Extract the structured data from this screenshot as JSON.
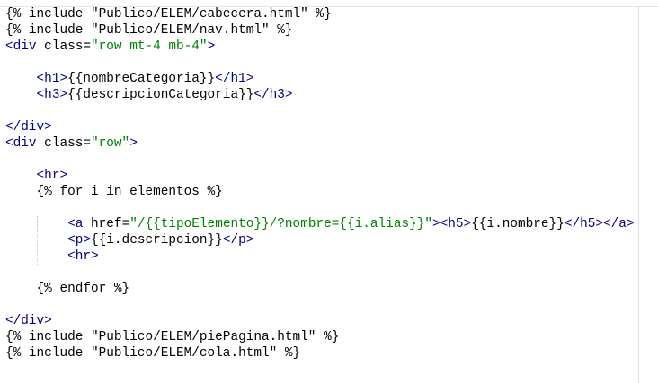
{
  "editor": {
    "lines": [
      [
        {
          "t": "{% include \"Publico/ELEM/cabecera.html\" %}",
          "c": "plain"
        }
      ],
      [
        {
          "t": "{% include \"Publico/ELEM/nav.html\" %}",
          "c": "plain"
        }
      ],
      [
        {
          "t": "<div",
          "c": "tag"
        },
        {
          "t": " class",
          "c": "attr"
        },
        {
          "t": "=",
          "c": "eq"
        },
        {
          "t": "\"row mt-4 mb-4\"",
          "c": "str"
        },
        {
          "t": ">",
          "c": "tag"
        }
      ],
      [],
      [
        {
          "t": "    ",
          "c": "plain"
        },
        {
          "t": "<h1>",
          "c": "tag"
        },
        {
          "t": "{{nombreCategoria}}",
          "c": "plain"
        },
        {
          "t": "</h1>",
          "c": "tag"
        }
      ],
      [
        {
          "t": "    ",
          "c": "plain"
        },
        {
          "t": "<h3>",
          "c": "tag"
        },
        {
          "t": "{{descripcionCategoria}}",
          "c": "plain"
        },
        {
          "t": "</h3>",
          "c": "tag"
        }
      ],
      [],
      [
        {
          "t": "</div>",
          "c": "tag"
        }
      ],
      [
        {
          "t": "<div",
          "c": "tag"
        },
        {
          "t": " class",
          "c": "attr"
        },
        {
          "t": "=",
          "c": "eq"
        },
        {
          "t": "\"row\"",
          "c": "str"
        },
        {
          "t": ">",
          "c": "tag"
        }
      ],
      [],
      [
        {
          "t": "    ",
          "c": "plain"
        },
        {
          "t": "<hr>",
          "c": "tag"
        }
      ],
      [
        {
          "t": "    {% for i in elementos %}",
          "c": "plain"
        }
      ],
      [],
      [
        {
          "t": "        ",
          "c": "plain"
        },
        {
          "t": "<a",
          "c": "tag"
        },
        {
          "t": " href",
          "c": "attr"
        },
        {
          "t": "=",
          "c": "eq"
        },
        {
          "t": "\"/{{tipoElemento}}/?nombre={{i.alias}}\"",
          "c": "str"
        },
        {
          "t": ">",
          "c": "tag"
        },
        {
          "t": "<h5>",
          "c": "tag"
        },
        {
          "t": "{{i.nombre}}",
          "c": "plain"
        },
        {
          "t": "</h5></a>",
          "c": "tag"
        }
      ],
      [
        {
          "t": "        ",
          "c": "plain"
        },
        {
          "t": "<p>",
          "c": "tag"
        },
        {
          "t": "{{i.descripcion}}",
          "c": "plain"
        },
        {
          "t": "</p>",
          "c": "tag"
        }
      ],
      [
        {
          "t": "        ",
          "c": "plain"
        },
        {
          "t": "<hr>",
          "c": "tag"
        }
      ],
      [],
      [
        {
          "t": "    {% endfor %}",
          "c": "plain"
        }
      ],
      [],
      [
        {
          "t": "</div>",
          "c": "tag"
        }
      ],
      [
        {
          "t": "{% include \"Publico/ELEM/piePagina.html\" %}",
          "c": "plain"
        }
      ],
      [
        {
          "t": "{% include \"Publico/ELEM/cola.html\" %}",
          "c": "plain"
        }
      ]
    ]
  }
}
